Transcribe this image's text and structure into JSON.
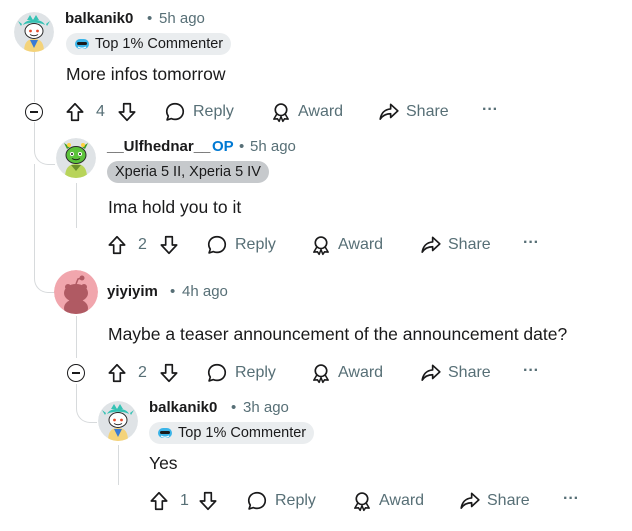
{
  "comments": [
    {
      "username": "balkanik0",
      "time": "5h ago",
      "flair": "Top 1% Commenter",
      "body": "More infos tomorrow",
      "votes": "4",
      "reply": "Reply",
      "award": "Award",
      "share": "Share",
      "more": "···"
    },
    {
      "username": "__Ulfhednar__",
      "op": "OP",
      "time": "5h ago",
      "flair": "Xperia 5 II, Xperia 5 IV",
      "body": "Ima hold you to it",
      "votes": "2",
      "reply": "Reply",
      "award": "Award",
      "share": "Share",
      "more": "···"
    },
    {
      "username": "yiyiyim",
      "time": "4h ago",
      "body": "Maybe a teaser announcement of the announcement date?",
      "votes": "2",
      "reply": "Reply",
      "award": "Award",
      "share": "Share",
      "more": "···"
    },
    {
      "username": "balkanik0",
      "time": "3h ago",
      "flair": "Top 1% Commenter",
      "body": "Yes",
      "votes": "1",
      "reply": "Reply",
      "award": "Award",
      "share": "Share",
      "more": "···"
    }
  ],
  "separator": "•",
  "colors": {
    "op": "#0079d3",
    "meta": "#576f76",
    "thread_line": "#d7dadc"
  },
  "icons": [
    "upvote-icon",
    "downvote-icon",
    "reply-icon",
    "award-icon",
    "share-icon",
    "more-icon",
    "collapse-icon",
    "top-commenter-icon"
  ]
}
